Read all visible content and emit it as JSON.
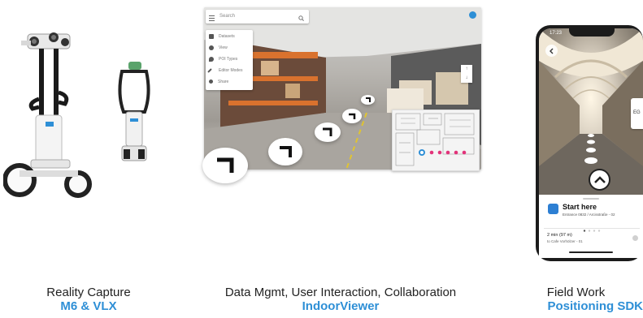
{
  "columns": [
    {
      "title": "Reality Capture",
      "subtitle": "M6 & VLX"
    },
    {
      "title": "Data Mgmt, User Interaction, Collaboration",
      "subtitle": "IndoorViewer"
    },
    {
      "title": "Field Work",
      "subtitle": "Positioning SDK"
    }
  ],
  "viewer": {
    "search_placeholder": "Search",
    "menu": [
      "Datasets",
      "View",
      "POI Types",
      "Editor Modes",
      "Share"
    ],
    "accent": "#2e8fd6"
  },
  "phone": {
    "time": "17:23",
    "start_title": "Start here",
    "start_sub": "Entrance 0832 / Arcisstraße - 02",
    "distance": "2 min (97 m)",
    "distance_sub": "to Cafe Vorhölzer - 01",
    "side_label": "EG"
  },
  "colors": {
    "accent_blue": "#2e8fd6",
    "text_dark": "#222222"
  }
}
